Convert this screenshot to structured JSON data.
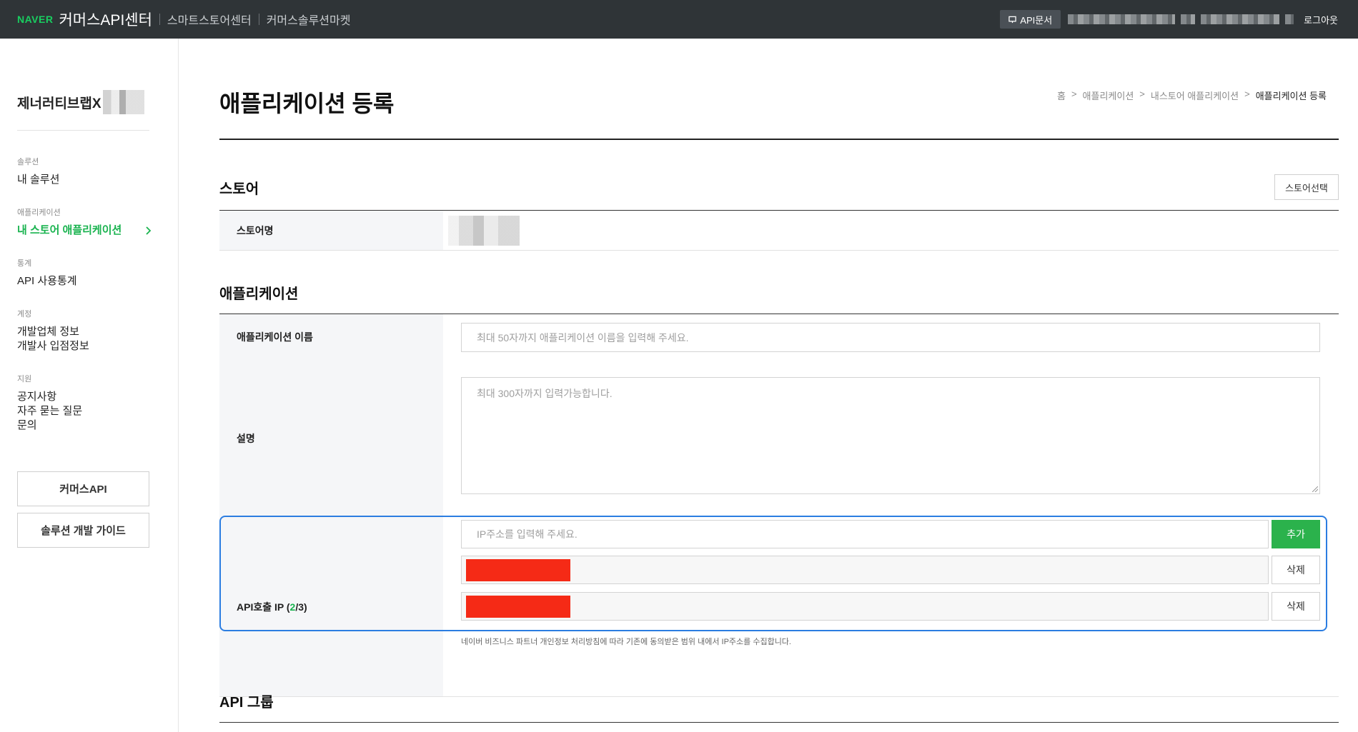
{
  "topbar": {
    "brand": "NAVER",
    "center_title": "커머스API센터",
    "links": [
      "스마트스토어센터",
      "커머스솔루션마켓"
    ],
    "api_doc_label": "API문서",
    "logout_label": "로그아웃"
  },
  "sidebar": {
    "store_title": "제너러티브랩X",
    "groups": [
      {
        "category": "솔루션",
        "items": [
          "내 솔루션"
        ]
      },
      {
        "category": "애플리케이션",
        "items": [
          "내 스토어 애플리케이션"
        ],
        "active": "내 스토어 애플리케이션"
      },
      {
        "category": "통계",
        "items": [
          "API 사용통계"
        ]
      },
      {
        "category": "계정",
        "items": [
          "개발업체 정보",
          "개발사 입점정보"
        ]
      },
      {
        "category": "지원",
        "items": [
          "공지사항",
          "자주 묻는 질문",
          "문의"
        ]
      }
    ],
    "buttons": [
      "커머스API",
      "솔루션 개발 가이드"
    ]
  },
  "main": {
    "page_title": "애플리케이션 등록",
    "breadcrumb": [
      "홈",
      ">",
      "애플리케이션",
      ">",
      "내스토어 애플리케이션",
      ">",
      "애플리케이션 등록"
    ],
    "store_section": {
      "title": "스토어",
      "select_button": "스토어선택",
      "store_name_label": "스토어명"
    },
    "app_section": {
      "title": "애플리케이션",
      "name_label": "애플리케이션 이름",
      "name_placeholder": "최대 50자까지 애플리케이션 이름을 입력해 주세요.",
      "desc_label": "설명",
      "desc_placeholder": "최대 300자까지 입력가능합니다.",
      "ip_label_prefix": "API호출 IP (",
      "ip_count": "2",
      "ip_label_suffix": "/3)",
      "ip_placeholder": "IP주소를 입력해 주세요.",
      "add_button": "추가",
      "delete_button": "삭제",
      "ip_note": "네이버 비즈니스 파트너 개인정보 처리방침에 따라 기존에 동의받은 범위 내에서 IP주소를 수집합니다."
    },
    "api_group_section": {
      "title": "API 그룹"
    }
  },
  "colors": {
    "accent_green": "#19b34f",
    "topbar_bg": "#2f3437",
    "highlight_blue": "#2b7de1",
    "redaction_red": "#f52a16"
  }
}
